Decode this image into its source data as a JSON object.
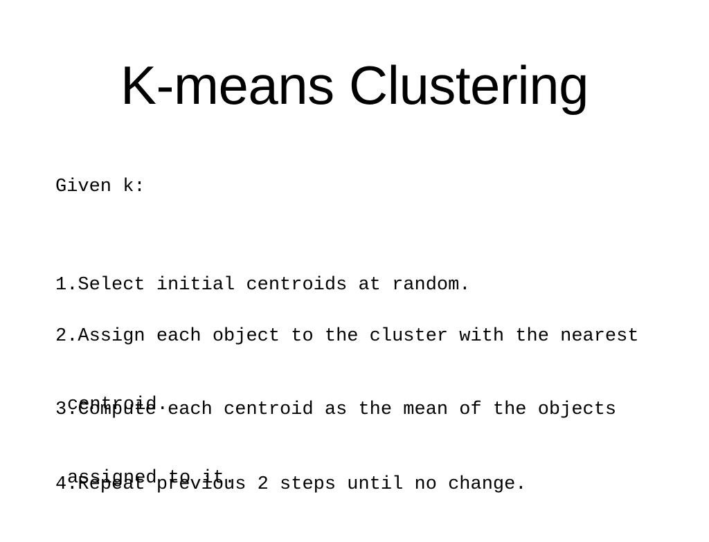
{
  "slide": {
    "title": "K-means Clustering",
    "intro": "Given k:",
    "steps": [
      {
        "number": "1.",
        "lines": [
          "Select initial centroids at random."
        ]
      },
      {
        "number": "2.",
        "lines": [
          "Assign each object to the cluster with the nearest",
          "centroid."
        ]
      },
      {
        "number": "3.",
        "lines": [
          "Compute each centroid as the mean of the objects",
          "assigned to it."
        ]
      },
      {
        "number": "4.",
        "lines": [
          "Repeat previous 2 steps until no change."
        ]
      }
    ]
  }
}
